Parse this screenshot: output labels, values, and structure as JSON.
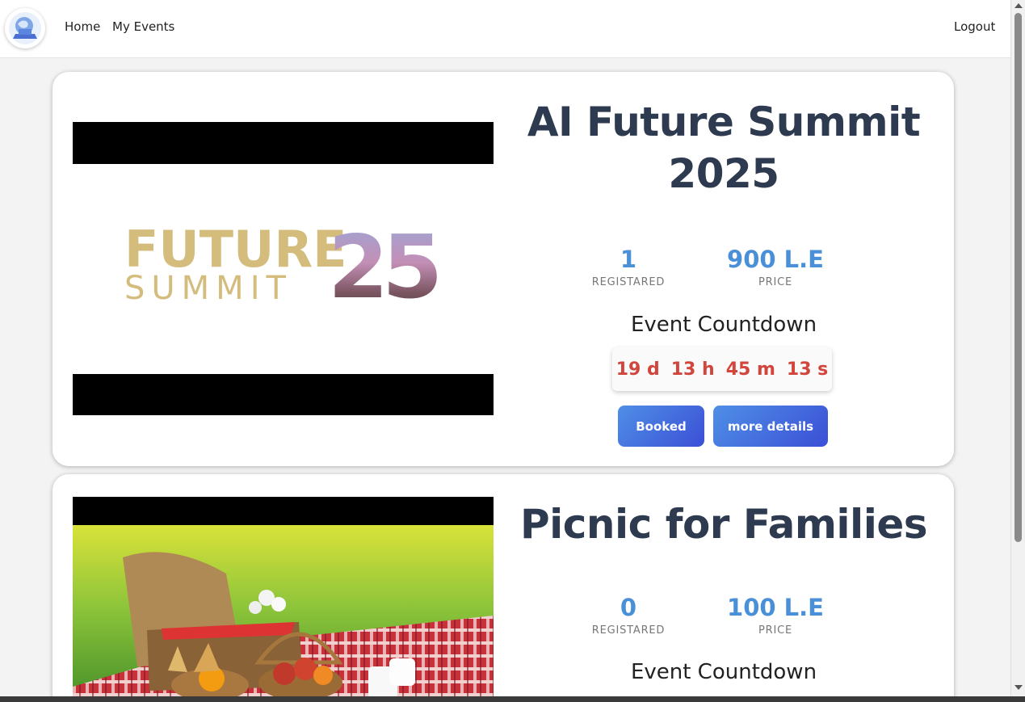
{
  "navbar": {
    "logo_icon": "globe-laptop-icon",
    "links": {
      "home": "Home",
      "my_events": "My Events",
      "logout": "Logout"
    }
  },
  "events": [
    {
      "title": "AI Future Summit 2025",
      "registered_value": "1",
      "registered_label": "REGISTARED",
      "price_value": "900 L.E",
      "price_label": "PRICE",
      "countdown_title": "Event Countdown",
      "countdown": {
        "days": "19 d",
        "hours": "13 h",
        "minutes": "45 m",
        "seconds": "13 s"
      },
      "booked_label": "Booked",
      "details_label": "more details",
      "image_text": {
        "line1": "FUTURE",
        "line2": "SUMMIT",
        "number": "25"
      }
    },
    {
      "title": "Picnic for Families",
      "registered_value": "0",
      "registered_label": "REGISTARED",
      "price_value": "100 L.E",
      "price_label": "PRICE",
      "countdown_title": "Event Countdown"
    }
  ],
  "colors": {
    "title": "#2d3a4f",
    "stat_value": "#4a90d9",
    "countdown": "#d2453c",
    "button_gradient_start": "#4f8fe6",
    "button_gradient_end": "#3b4fd6"
  }
}
